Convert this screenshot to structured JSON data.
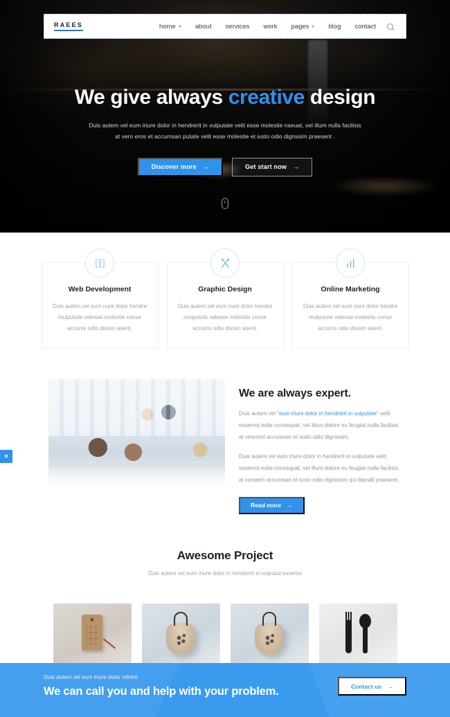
{
  "navbar": {
    "logo": "RAEES",
    "items": [
      {
        "label": "home",
        "has_caret": true
      },
      {
        "label": "about",
        "has_caret": false
      },
      {
        "label": "services",
        "has_caret": false
      },
      {
        "label": "work",
        "has_caret": false
      },
      {
        "label": "pages",
        "has_caret": true
      },
      {
        "label": "blog",
        "has_caret": false
      },
      {
        "label": "contact",
        "has_caret": false
      }
    ],
    "search_icon": "search-icon"
  },
  "hero": {
    "title_part1": "We give always ",
    "title_highlight": "creative",
    "title_part2": " design",
    "subtitle": "Duis autem vel eum iriure dolor in hendrerit in vulputate velit esse molestie nseuat, vel illum nulla facilisis at vero eros et accumsan putate velit esse molestie et iusto odio dignssim praesent .",
    "btn_primary": "Discover more",
    "btn_secondary": "Get start now",
    "arrow": "→",
    "scroll_icon": "mouse-scroll-icon"
  },
  "services": [
    {
      "icon": "web-development-icon",
      "title": "Web Development",
      "text": "Duis autem vel eum nure dolor hendre mulputote velesse molestie conse accums odio dissim asent."
    },
    {
      "icon": "graphic-design-icon",
      "title": "Graphic Design",
      "text": "Duis autem vel eum nure dolor hendre mulputote velesse molestie conse accums odio dissim asent."
    },
    {
      "icon": "online-marketing-icon",
      "title": "Online Marketing",
      "text": "Duis autem vel eum nure dolor hendre mulputote velesse molestie conse accums odio dissim asent."
    }
  ],
  "expert": {
    "image_alt": "business-team-meeting-photo",
    "title": "We are always expert.",
    "paragraph1_pre": "Duis autem vel ",
    "paragraph1_quote": "\"eum iriure dolor in hendrerit in vulputate\"",
    "paragraph1_post": " velit essemol estie consequat, vel illum dolore eu feugiat nulla facilisis at vererost accumsan et iusto odio dignissim.",
    "paragraph2": "Duis autem vel eum iriure dolor in hendrerit in vulputate velit essemol estie consequat, vel illum dolore eu feugiat nulla facilisis at veroeim accumsan et iusto odio dignissim qui blandit praesent.",
    "btn_read": "Read more",
    "arrow": "→"
  },
  "projects": {
    "title": "Awesome Project",
    "subtitle": "Duis autem vel eum iriure dolor in hendrerit in vulputat essemo",
    "items": [
      {
        "name": "paper-tag-project"
      },
      {
        "name": "drawstring-pouch-project"
      },
      {
        "name": "printed-pouch-project"
      },
      {
        "name": "cutlery-project"
      }
    ]
  },
  "cta": {
    "small": "Duis autem vel eum iriure dolor ndrerit",
    "headline": "We can call you and help with your problem.",
    "button": "Contact us",
    "arrow": "→"
  },
  "left_tab": {
    "label": "✕"
  },
  "colors": {
    "accent": "#2f93eb",
    "cta_bg": "#3a9aee",
    "heading": "#1b1f26",
    "body_text": "#9aa0a8"
  }
}
